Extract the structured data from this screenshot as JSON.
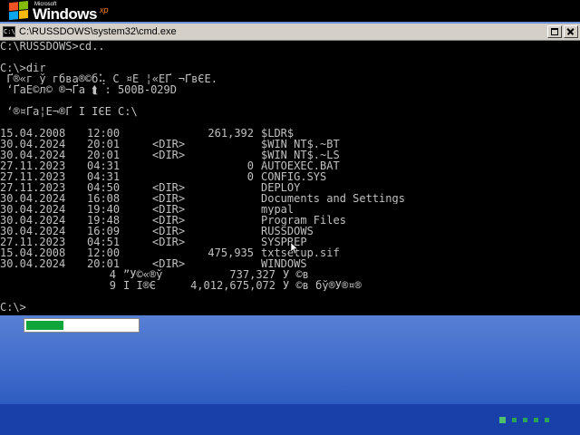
{
  "brand": {
    "microsoft": "Microsoft",
    "windows": "Windows",
    "xp": "xp"
  },
  "window": {
    "title": "C:\\RUSSDOWS\\system32\\cmd.exe",
    "icon_label": "C:\\"
  },
  "console": {
    "lines": [
      "C:\\RUSSDOWS>cd..",
      "",
      "C:\\>dir",
      " Ґ®«г ў гбва®©б⢥ C ¤Ё ¦«ЁҐ ¬ҐвЄЁ.",
      " ‘ҐаЁ©­л© ­®¬Ґа ⮬ : 500B-029D",
      "",
      " ‘®¤Ґа¦Ё¬®Ґ Ї ЇЄЁ C:\\",
      ""
    ],
    "entries": [
      {
        "date": "15.04.2008",
        "time": "12:00",
        "dir": "",
        "size": "261,392",
        "name": "$LDR$"
      },
      {
        "date": "30.04.2024",
        "time": "20:01",
        "dir": "<DIR>",
        "size": "",
        "name": "$WIN_NT$.~BT"
      },
      {
        "date": "30.04.2024",
        "time": "20:01",
        "dir": "<DIR>",
        "size": "",
        "name": "$WIN_NT$.~LS"
      },
      {
        "date": "27.11.2023",
        "time": "04:31",
        "dir": "",
        "size": "0",
        "name": "AUTOEXEC.BAT"
      },
      {
        "date": "27.11.2023",
        "time": "04:31",
        "dir": "",
        "size": "0",
        "name": "CONFIG.SYS"
      },
      {
        "date": "27.11.2023",
        "time": "04:50",
        "dir": "<DIR>",
        "size": "",
        "name": "DEPLOY"
      },
      {
        "date": "30.04.2024",
        "time": "16:08",
        "dir": "<DIR>",
        "size": "",
        "name": "Documents and Settings"
      },
      {
        "date": "30.04.2024",
        "time": "19:40",
        "dir": "<DIR>",
        "size": "",
        "name": "mypal"
      },
      {
        "date": "30.04.2024",
        "time": "19:48",
        "dir": "<DIR>",
        "size": "",
        "name": "Program Files"
      },
      {
        "date": "30.04.2024",
        "time": "16:09",
        "dir": "<DIR>",
        "size": "",
        "name": "RUSSDOWS"
      },
      {
        "date": "27.11.2023",
        "time": "04:51",
        "dir": "<DIR>",
        "size": "",
        "name": "SYSPREP"
      },
      {
        "date": "15.04.2008",
        "time": "12:00",
        "dir": "",
        "size": "475,935",
        "name": "txtsetup.sif"
      },
      {
        "date": "30.04.2024",
        "time": "20:01",
        "dir": "<DIR>",
        "size": "",
        "name": "WINDOWS"
      }
    ],
    "summary_files": {
      "count": "4",
      "label": "”Ў©«®ў",
      "bytes": "737,327",
      "unit": "Ў ©в"
    },
    "summary_dirs": {
      "count": "9",
      "label": "Ї Ї®Є",
      "bytes": "4,012,675,072",
      "unit": "Ў ©в бў®Ў®¤­®"
    },
    "prompt": "C:\\>"
  },
  "boot": {
    "progress_fraction": 0.34
  },
  "colors": {
    "console_text": "#c0c0c0",
    "loader_fill": "#0ea53a",
    "band": "#1840a8"
  }
}
